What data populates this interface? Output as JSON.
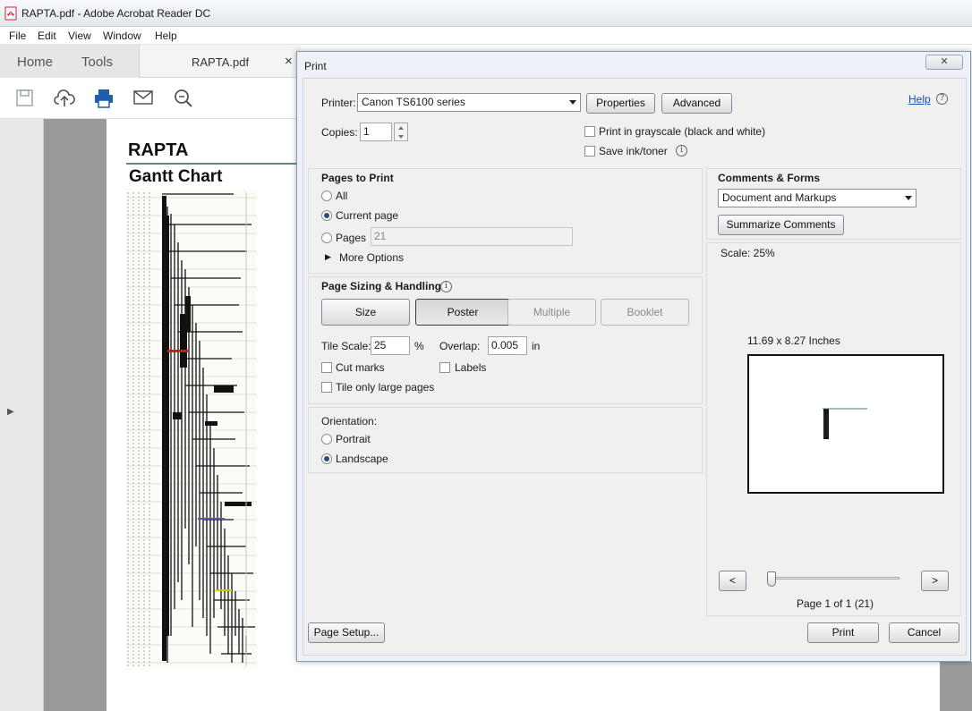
{
  "app": {
    "title": "RAPTA.pdf - Adobe Acrobat Reader DC"
  },
  "menu": [
    "File",
    "Edit",
    "View",
    "Window",
    "Help"
  ],
  "tabs": {
    "home": "Home",
    "tools": "Tools",
    "doc": "RAPTA.pdf",
    "close": "×"
  },
  "toolbar": {
    "icons": [
      "save-icon",
      "upload-icon",
      "print-icon",
      "mail-icon",
      "zoom-search-icon"
    ]
  },
  "document": {
    "title": "RAPTA",
    "subtitle": "Gantt Chart"
  },
  "dialog": {
    "title": "Print",
    "close": "✕",
    "printer_label": "Printer:",
    "printer_value": "Canon TS6100 series",
    "properties": "Properties",
    "advanced": "Advanced",
    "help": "Help",
    "copies_label": "Copies:",
    "copies_value": "1",
    "grayscale": "Print in grayscale (black and white)",
    "save_ink": "Save ink/toner",
    "pages_to_print": {
      "heading": "Pages to Print",
      "all": "All",
      "current": "Current page",
      "pages": "Pages",
      "pages_value": "21",
      "more": "More Options"
    },
    "sizing": {
      "heading": "Page Sizing & Handling",
      "size": "Size",
      "poster": "Poster",
      "multiple": "Multiple",
      "booklet": "Booklet",
      "tile_scale_label": "Tile Scale:",
      "tile_scale_value": "25",
      "percent": "%",
      "overlap_label": "Overlap:",
      "overlap_value": "0.005",
      "in": "in",
      "cut_marks": "Cut marks",
      "labels": "Labels",
      "tile_large": "Tile only large pages"
    },
    "orientation": {
      "heading": "Orientation:",
      "portrait": "Portrait",
      "landscape": "Landscape"
    },
    "comments": {
      "heading": "Comments & Forms",
      "value": "Document and Markups",
      "summarize": "Summarize Comments"
    },
    "preview": {
      "scale": "Scale:  25%",
      "dims": "11.69 x 8.27 Inches",
      "prev": "<",
      "next": ">",
      "page_info": "Page 1 of 1 (21)"
    },
    "page_setup": "Page Setup...",
    "print": "Print",
    "cancel": "Cancel"
  }
}
